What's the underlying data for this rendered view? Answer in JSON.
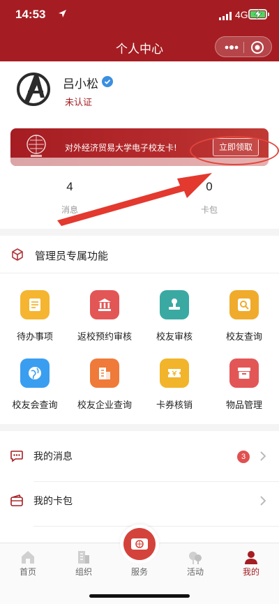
{
  "status_bar": {
    "time": "14:53",
    "network": "4G"
  },
  "nav": {
    "title": "个人中心"
  },
  "profile": {
    "name": "吕小松",
    "cert_status": "未认证"
  },
  "banner": {
    "text": "对外经济贸易大学电子校友卡!",
    "button": "立即领取"
  },
  "stats": [
    {
      "value": "4",
      "label": "消息"
    },
    {
      "value": "0",
      "label": "卡包"
    }
  ],
  "admin": {
    "title": "管理员专属功能",
    "items": [
      {
        "label": "待办事项",
        "icon": "todo-icon",
        "color": "#f5b530"
      },
      {
        "label": "返校预约审核",
        "icon": "bank-icon",
        "color": "#e35656"
      },
      {
        "label": "校友审核",
        "icon": "stamp-icon",
        "color": "#3aa9a2"
      },
      {
        "label": "校友查询",
        "icon": "person-search-icon",
        "color": "#f0ab2c"
      },
      {
        "label": "校友会查询",
        "icon": "globe-icon",
        "color": "#3a9ef0"
      },
      {
        "label": "校友企业查询",
        "icon": "building-icon",
        "color": "#ef7a3a"
      },
      {
        "label": "卡券核销",
        "icon": "coupon-icon",
        "color": "#f2b42a"
      },
      {
        "label": "物品管理",
        "icon": "box-icon",
        "color": "#e35656"
      }
    ]
  },
  "list": {
    "messages": {
      "label": "我的消息",
      "badge": "3"
    },
    "cards": {
      "label": "我的卡包"
    }
  },
  "tabbar": [
    {
      "label": "首页",
      "icon": "home-icon"
    },
    {
      "label": "组织",
      "icon": "organization-icon"
    },
    {
      "label": "服务",
      "icon": "service-icon"
    },
    {
      "label": "活动",
      "icon": "activity-icon"
    },
    {
      "label": "我的",
      "icon": "me-icon",
      "active": true
    }
  ],
  "colors": {
    "brand": "#a51d22",
    "accent_red": "#e2453c"
  }
}
